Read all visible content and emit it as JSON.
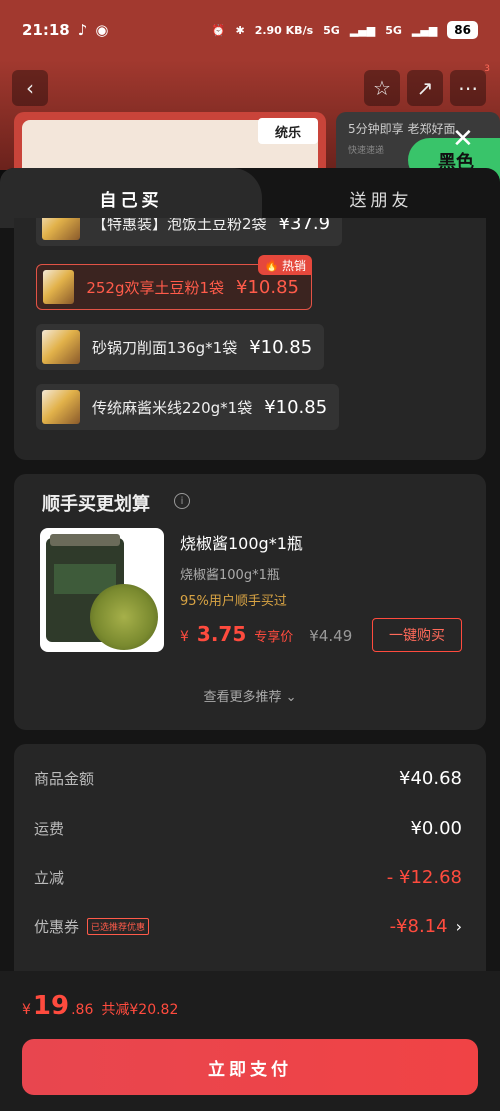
{
  "status_bar": {
    "time": "21:18",
    "net_speed": "2.90 KB/s",
    "signal1": "5G",
    "signal2": "5G",
    "battery": "86"
  },
  "header": {
    "more_badge": "3",
    "banner_brand": "统乐",
    "banner2_line1": "5分钟即享 老郑好面",
    "banner2_line2": "快速速递",
    "green_tag": "黑色"
  },
  "tabs": {
    "self": "自己买",
    "friend": "送朋友"
  },
  "variants": [
    {
      "label": "【特惠装】泡饭土豆粉2袋",
      "price": "¥37.9"
    },
    {
      "label": "252g欢享土豆粉1袋",
      "price": "¥10.85",
      "badge": "热销"
    },
    {
      "label": "砂锅刀削面136g*1袋",
      "price": "¥10.85"
    },
    {
      "label": "传统麻酱米线220g*1袋",
      "price": "¥10.85"
    }
  ],
  "recommend": {
    "title": "顺手买更划算",
    "name": "烧椒酱100g*1瓶",
    "sub": "烧椒酱100g*1瓶",
    "note": "95%用户顺手买过",
    "price_currency": "¥",
    "price": "3.75",
    "price_tag": "专享价",
    "old_price": "¥4.49",
    "buy_button": "一键购买",
    "more": "查看更多推荐"
  },
  "summary": {
    "goods_label": "商品金额",
    "goods_value": "¥40.68",
    "shipping_label": "运费",
    "shipping_value": "¥0.00",
    "discount_label": "立减",
    "discount_value": "- ¥12.68",
    "coupon_label": "优惠券",
    "coupon_chip": "已选推荐优惠",
    "coupon_value": "-¥8.14"
  },
  "footer": {
    "currency": "¥",
    "total_int": "19",
    "total_dec": ".86",
    "saved": "共减¥20.82",
    "pay_button": "立即支付"
  }
}
